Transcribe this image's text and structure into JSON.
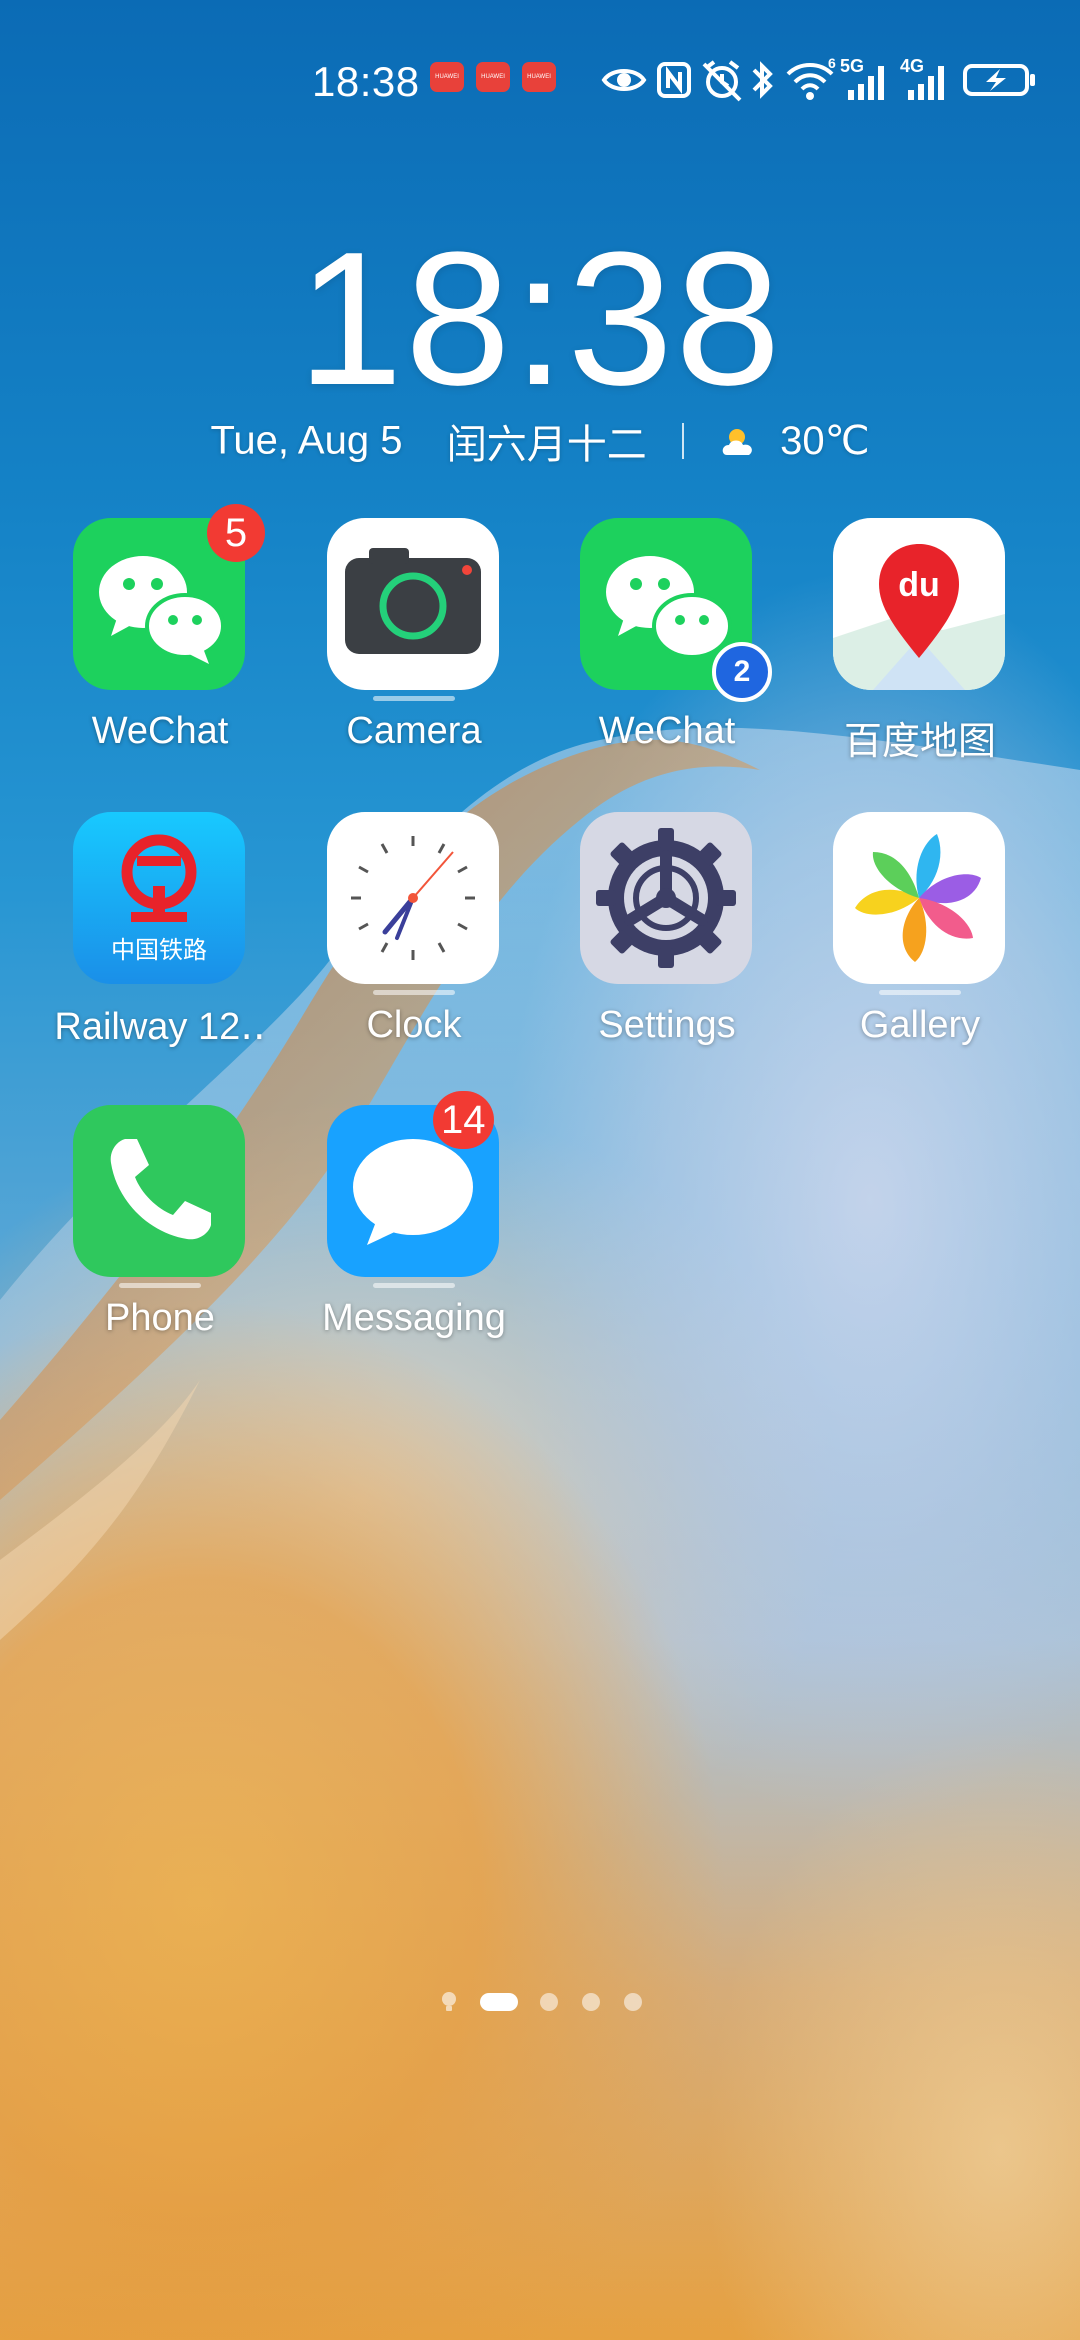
{
  "status_bar": {
    "time": "18:38",
    "notification_apps": [
      "HUAWEI",
      "HUAWEI",
      "HUAWEI"
    ],
    "network_labels": [
      "5G",
      "4G"
    ],
    "indicator_icons": [
      "eye-icon",
      "nfc-icon",
      "alarm-icon",
      "bluetooth-icon",
      "wifi-icon",
      "signal-5g-icon",
      "signal-4g-icon",
      "battery-charging-icon"
    ]
  },
  "clock_widget": {
    "time": "18:38",
    "date": "Tue, Aug 5",
    "lunar_date": "闰六月十二",
    "temperature": "30℃",
    "weather_icon": "partly-sunny-icon"
  },
  "apps": [
    {
      "label": "WeChat",
      "badge": "5"
    },
    {
      "label": "Camera"
    },
    {
      "label": "WeChat",
      "clone_badge": "2"
    },
    {
      "label": "百度地图",
      "icon_text": "du"
    },
    {
      "label": "Railway 12‥",
      "icon_text": "中国铁路"
    },
    {
      "label": "Clock"
    },
    {
      "label": "Settings"
    },
    {
      "label": "Gallery"
    },
    {
      "label": "Phone"
    },
    {
      "label": "Messaging",
      "badge": "14"
    }
  ],
  "pager": {
    "pages": 5,
    "active_page": 1,
    "first_is_tips": true
  },
  "colors": {
    "wechat_green": "#1dd15d",
    "badge_red": "#f23a33",
    "clone_blue": "#1f66e0",
    "phone_green": "#2fc85d",
    "messaging_blue": "#18a2ff"
  }
}
